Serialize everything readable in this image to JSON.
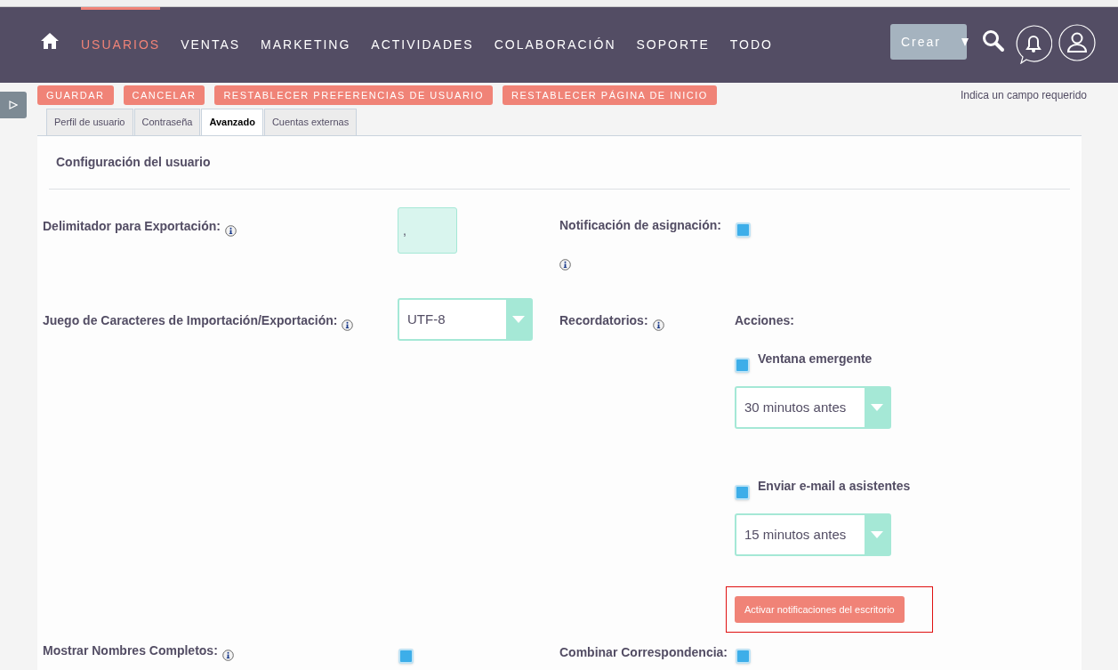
{
  "top_nav": {
    "items": [
      {
        "label": "USUARIOS",
        "selected": true
      },
      {
        "label": "VENTAS",
        "selected": false
      },
      {
        "label": "MARKETING",
        "selected": false
      },
      {
        "label": "ACTIVIDADES",
        "selected": false
      },
      {
        "label": "COLABORACIÓN",
        "selected": false
      },
      {
        "label": "SOPORTE",
        "selected": false
      },
      {
        "label": "TODO",
        "selected": false
      }
    ],
    "create_button": "Crear"
  },
  "action_buttons": [
    "GUARDAR",
    "CANCELAR",
    "RESTABLECER PREFERENCIAS DE USUARIO",
    "RESTABLECER PÁGINA DE INICIO"
  ],
  "required_note": "Indica un campo requerido",
  "tabs": [
    {
      "label": "Perfil de usuario",
      "selected": false
    },
    {
      "label": "Contraseña",
      "selected": false
    },
    {
      "label": "Avanzado",
      "selected": true
    },
    {
      "label": "Cuentas externas",
      "selected": false
    }
  ],
  "section_title": "Configuración del usuario",
  "export_delimiter": {
    "label": "Delimitador para Exportación:",
    "value": ","
  },
  "charset": {
    "label": "Juego de Caracteres de Importación/Exportación:",
    "value": "UTF-8"
  },
  "assignment_notification": {
    "label": "Notificación de asignación:",
    "checked": true
  },
  "reminders": {
    "label": "Recordatorios:",
    "actions_label": "Acciones:",
    "actions": [
      {
        "label": "Ventana emergente",
        "checked": true,
        "value": "30 minutos antes"
      },
      {
        "label": "Enviar e-mail a asistentes",
        "checked": true,
        "value": "15 minutos antes"
      }
    ],
    "desktop_button": "Activar notificaciones del escritorio"
  },
  "full_names": {
    "label": "Mostrar Nombres Completos:",
    "checked": true
  },
  "mail_merge": {
    "label": "Combinar Correspondencia:",
    "checked": true
  }
}
